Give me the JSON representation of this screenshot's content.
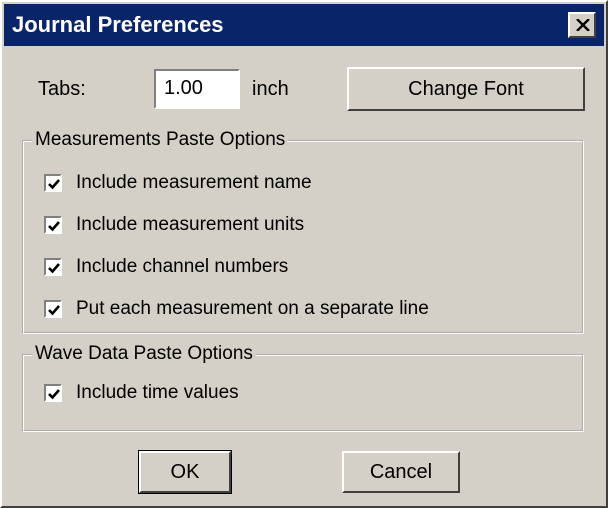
{
  "window": {
    "title": "Journal Preferences"
  },
  "tabs": {
    "label": "Tabs:",
    "value": "1.00",
    "unit": "inch"
  },
  "change_font_label": "Change Font",
  "measurements": {
    "legend": "Measurements Paste Options",
    "items": [
      {
        "label": "Include measurement name",
        "checked": true
      },
      {
        "label": "Include measurement units",
        "checked": true
      },
      {
        "label": "Include channel numbers",
        "checked": true
      },
      {
        "label": "Put each measurement on a separate line",
        "checked": true
      }
    ]
  },
  "wave": {
    "legend": "Wave Data Paste Options",
    "items": [
      {
        "label": "Include time values",
        "checked": true
      }
    ]
  },
  "buttons": {
    "ok": "OK",
    "cancel": "Cancel"
  },
  "colors": {
    "titlebar": "#0a246a",
    "face": "#d4d0c8"
  },
  "icons": {
    "close": "close-icon",
    "check": "checkmark-icon"
  }
}
